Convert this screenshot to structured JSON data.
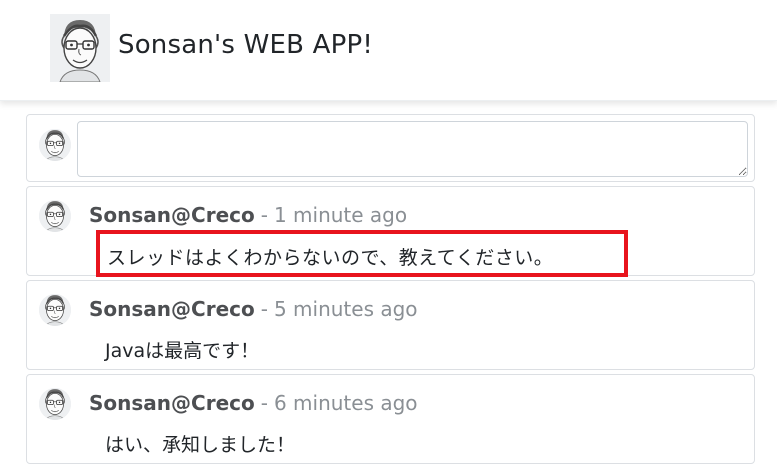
{
  "header": {
    "app_title": "Sonsan's WEB APP!",
    "logo_icon": "avatar-sketch-icon"
  },
  "composer": {
    "placeholder": "",
    "value": ""
  },
  "comments": [
    {
      "author": "Sonsan@Creco",
      "separator": "-",
      "time": "1 minute ago",
      "text": "スレッドはよくわからないので、教えてください。",
      "highlighted": true
    },
    {
      "author": "Sonsan@Creco",
      "separator": "-",
      "time": "5 minutes ago",
      "text": "Javaは最高です！",
      "highlighted": false
    },
    {
      "author": "Sonsan@Creco",
      "separator": "-",
      "time": "6 minutes ago",
      "text": "はい、承知しました！",
      "highlighted": false
    }
  ],
  "colors": {
    "highlight_border": "#e8141d",
    "author": "#4d4f52",
    "meta": "#8a8f94"
  }
}
